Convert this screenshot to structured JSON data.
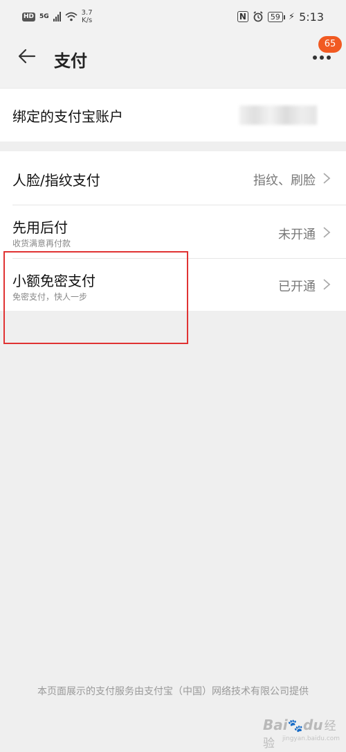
{
  "status_bar": {
    "hd": "HD",
    "network": "5G",
    "speed_value": "3.7",
    "speed_unit": "K/s",
    "nfc": "N",
    "battery": "59",
    "time": "5:13"
  },
  "header": {
    "title": "支付",
    "notification_count": "65"
  },
  "account": {
    "label": "绑定的支付宝账户"
  },
  "items": [
    {
      "label": "人脸/指纹支付",
      "sub": "",
      "value": "指纹、刷脸"
    },
    {
      "label": "先用后付",
      "sub": "收货满意再付款",
      "value": "未开通"
    },
    {
      "label": "小额免密支付",
      "sub": "免密支付，快人一步",
      "value": "已开通"
    }
  ],
  "footer": {
    "text": "本页面展示的支付服务由支付宝（中国）网络技术有限公司提供"
  },
  "watermark": {
    "brand_a": "Bai",
    "brand_b": "du",
    "brand_c": "经验",
    "url": "jingyan.baidu.com"
  },
  "colors": {
    "accent": "#f15a22",
    "highlight": "#e03232",
    "background": "#efefef"
  }
}
